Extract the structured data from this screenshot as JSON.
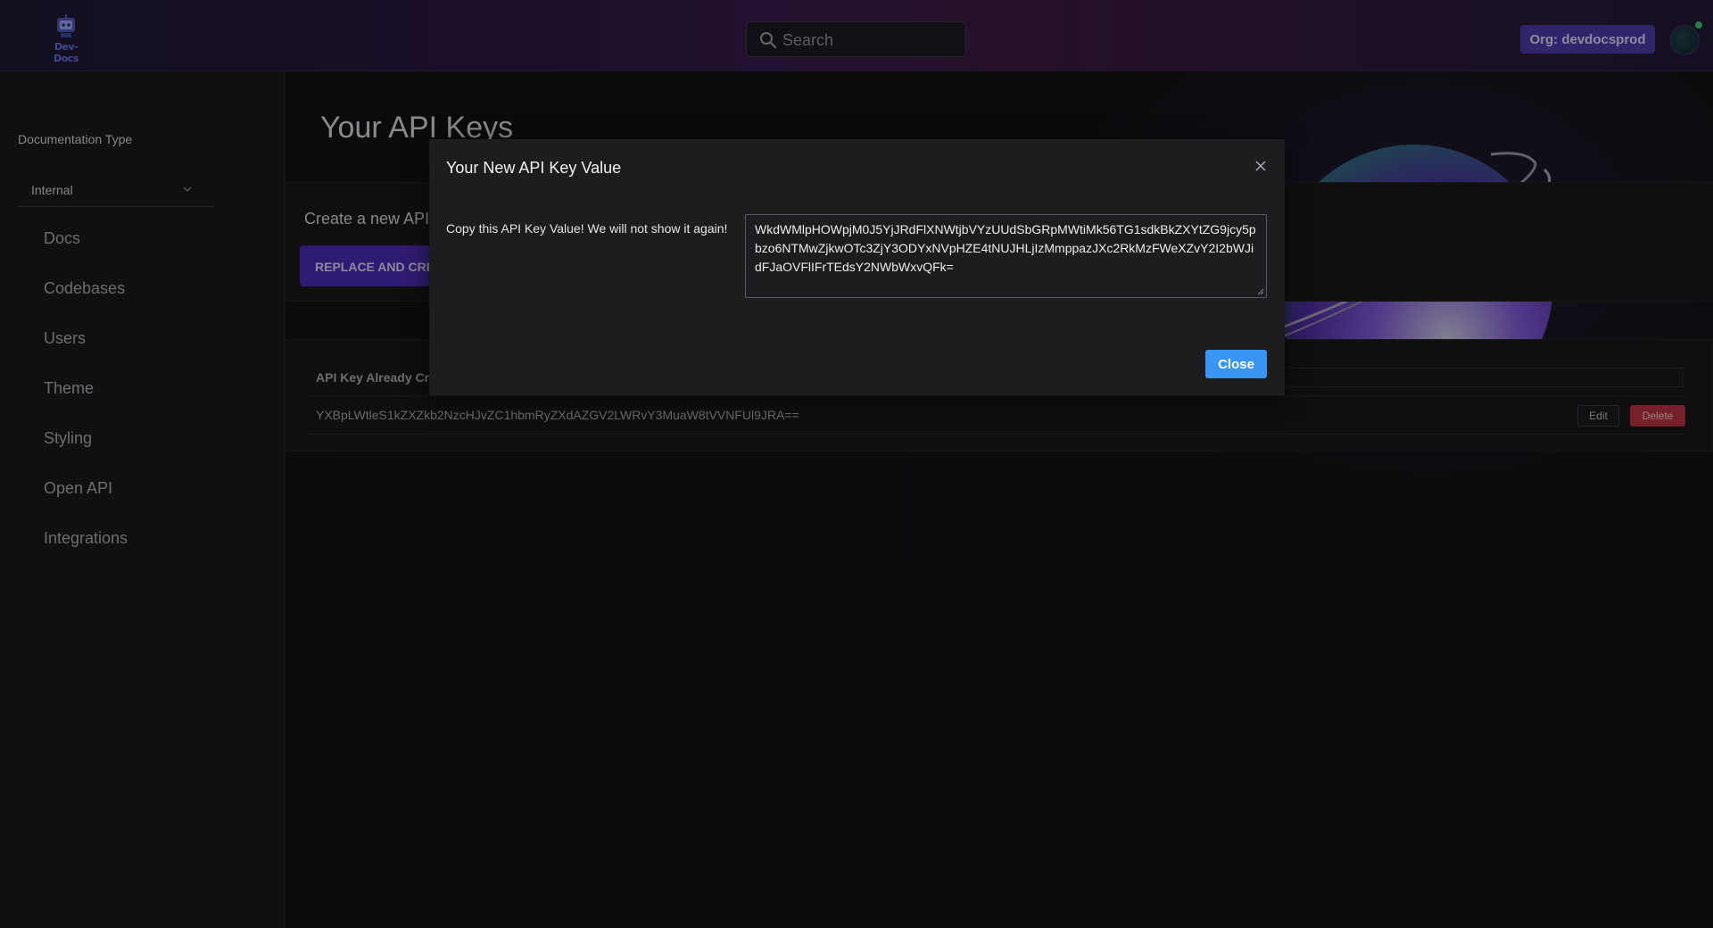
{
  "header": {
    "logo_text": "Dev-Docs",
    "search_placeholder": "Search",
    "org_label": "Org: devdocsprod"
  },
  "sidebar": {
    "doc_type_label": "Documentation Type",
    "doc_type_value": "Internal",
    "items": [
      "Docs",
      "Codebases",
      "Users",
      "Theme",
      "Styling",
      "Open API",
      "Integrations"
    ]
  },
  "main": {
    "title": "Your API Keys",
    "create_subtitle": "Create a new API",
    "replace_button": "REPLACE AND CRE",
    "keys_header": "API Key Already Cr",
    "existing_key": "YXBpLWtleS1kZXZkb2NzcHJvZC1hbmRyZXdAZGV2LWRvY3MuaW8tVVNFUl9JRA==",
    "edit_label": "Edit",
    "delete_label": "Delete"
  },
  "modal": {
    "title": "Your New API Key Value",
    "label": "Copy this API Key Value! We will not show it again!",
    "key_value": "WkdWMlpHOWpjM0J5YjJRdFlXNWtjbVYzUUdSbGRpMWtiMk56TG1sdkBkZXYtZG9jcy5pbzo6NTMwZjkwOTc3ZjY3ODYxNVpHZE4tNUJHLjIzMmppazJXc2RkMzFWeXZvY2I2bWJidFJaOVFlIFrTEdsY2NWbWxvQFk=",
    "close_label": "Close"
  },
  "colors": {
    "accent_purple": "#4a2ab0",
    "close_blue": "#3b95f3",
    "delete_red": "#b6333f"
  }
}
